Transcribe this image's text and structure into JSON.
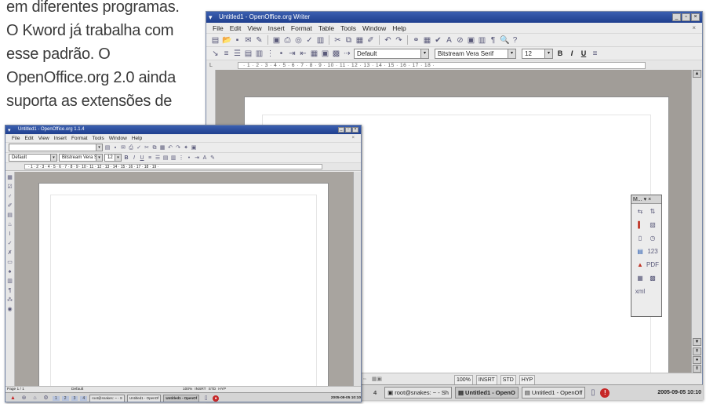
{
  "article": {
    "lines": [
      "em diferentes programas.",
      "O Kword já trabalha com",
      "esse padrão. O",
      "OpenOffice.org 2.0 ainda",
      "suporta as extensões de"
    ]
  },
  "big_window": {
    "title": "Untitled1 - OpenOffice.org Writer",
    "menus": [
      "File",
      "Edit",
      "View",
      "Insert",
      "Format",
      "Table",
      "Tools",
      "Window",
      "Help"
    ],
    "paragraph_style": "Default",
    "font_name": "Bitstream Vera Serif",
    "font_size": "12",
    "bold_label": "B",
    "italic_label": "I",
    "underline_label": "U",
    "ruler_text": "· 1 · 2 · 3 · 4 · 5 · 6 · 7 · 8 · 9 · 10 · 11 · 12 · 13 · 14 · 15 · 16 · 17 · 18 ·",
    "floating_panel_title": "M... ▾ ×",
    "floating_panel_items": [
      "1",
      "123",
      "PDF",
      "xml"
    ],
    "status": {
      "zoom": "100%",
      "insert": "INSRT",
      "std": "STD",
      "hyp": "HYP"
    },
    "taskbar": {
      "desktop": "4",
      "tasks": [
        "root@snakes: ~ - Sh",
        "Untitled1 - OpenO",
        "Untitled1 - OpenOff"
      ],
      "clock": "2005-09-05 10:10",
      "alert": "!"
    }
  },
  "small_window": {
    "title": "Untitled1 - OpenOffice.org 1.1.4",
    "menus": [
      "File",
      "Edit",
      "View",
      "Insert",
      "Format",
      "Tools",
      "Window",
      "Help"
    ],
    "paragraph_style": "Default",
    "font_name": "Bitstream Vera S",
    "font_size": "12",
    "ruler_text": "· 1 · 2 · 3 · 4 · 5 · 6 · 7 · 8 · 9 · 10 · 11 · 12 · 13 · 14 · 15 · 16 · 17 · 18 · 19 ·",
    "status": {
      "page": "Page 1 / 1",
      "style": "Default",
      "zoom": "100%",
      "insert": "INSRT",
      "std": "STD",
      "hyp": "HYP"
    },
    "taskbar": {
      "desktops": [
        "1",
        "2",
        "3",
        "4"
      ],
      "tasks": [
        "root@snakes: ~ - S",
        "Untitled1 - OpenOf",
        "Untitled1 - OpenOf"
      ],
      "clock": "2005-09-05 10:10"
    }
  }
}
